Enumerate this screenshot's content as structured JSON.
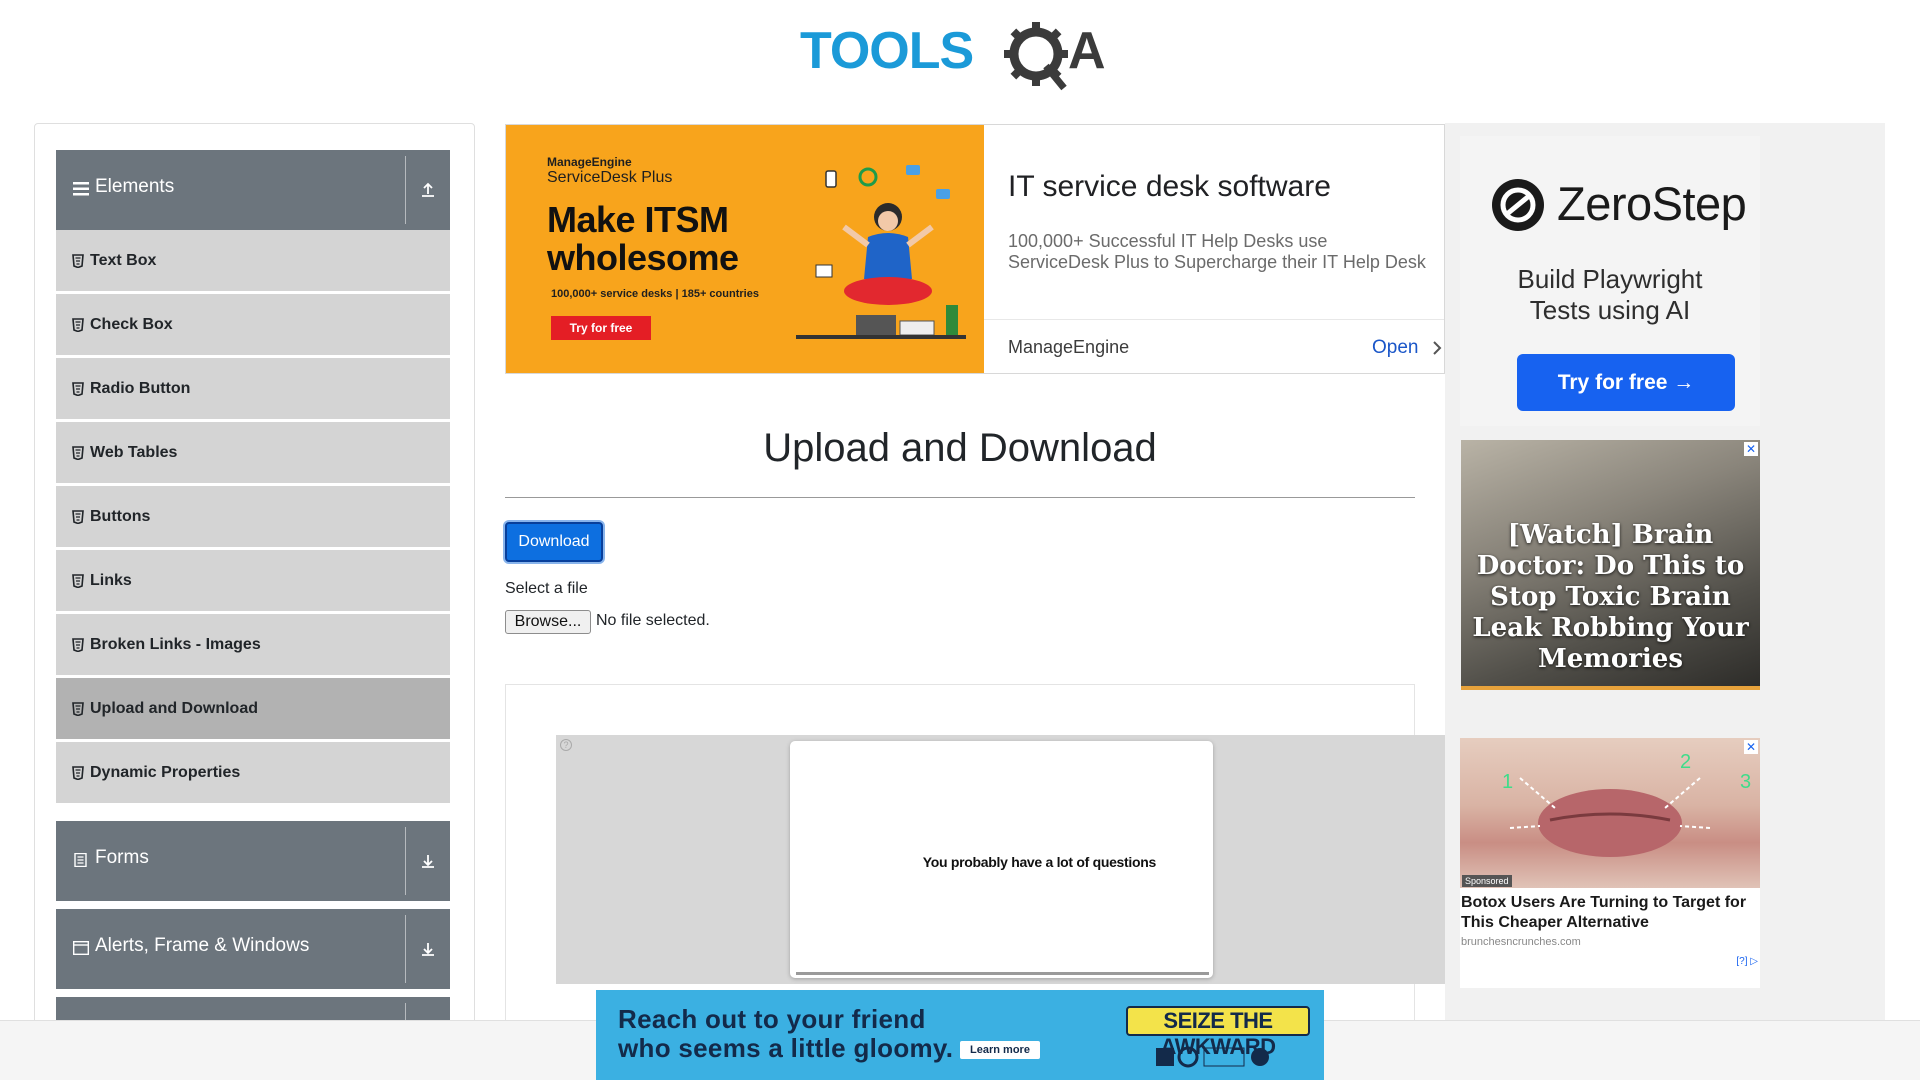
{
  "header": {
    "logo_text": "TOOLSQA"
  },
  "sidebar": {
    "groups": [
      {
        "label": "Elements",
        "icon": "hamburger-icon",
        "expanded": true
      },
      {
        "label": "Forms",
        "icon": "form-icon",
        "expanded": false
      },
      {
        "label": "Alerts, Frame & Windows",
        "icon": "window-icon",
        "expanded": false
      }
    ],
    "items": [
      {
        "label": "Text Box"
      },
      {
        "label": "Check Box"
      },
      {
        "label": "Radio Button"
      },
      {
        "label": "Web Tables"
      },
      {
        "label": "Buttons"
      },
      {
        "label": "Links"
      },
      {
        "label": "Broken Links - Images"
      },
      {
        "label": "Upload and Download",
        "active": true
      },
      {
        "label": "Dynamic Properties"
      }
    ]
  },
  "ad_top": {
    "brand_small": "ManageEngine",
    "brand_product": "ServiceDesk Plus",
    "headline_line1": "Make ITSM",
    "headline_line2": "wholesome",
    "stat": "100,000+ service desks | 185+ countries",
    "banner_cta": "Try for free",
    "title": "IT service desk software",
    "description": "100,000+ Successful IT Help Desks use ServiceDesk Plus to Supercharge their IT Help Desk",
    "advertiser": "ManageEngine",
    "open_label": "Open",
    "banner_color": "#f8a41c"
  },
  "main": {
    "page_title": "Upload and Download",
    "download_label": "Download",
    "select_file_label": "Select a file",
    "browse_label": "Browse...",
    "no_file_text": "No file selected."
  },
  "video_ad": {
    "text": "You probably have a lot of questions"
  },
  "right_ads": {
    "zerostep": {
      "name": "ZeroStep",
      "tagline_line1": "Build Playwright",
      "tagline_line2": "Tests using AI",
      "cta": "Try for free →",
      "button_color": "#1762f0"
    },
    "brain": {
      "text": "[Watch] Brain Doctor: Do This to Stop Toxic Brain Leak Robbing Your Memories"
    },
    "botox": {
      "sponsored": "Sponsored",
      "title": "Botox Users Are Turning to Target for This Cheaper Alternative",
      "domain": "brunchesncrunches.com",
      "adchoice": "[?]"
    }
  },
  "bottom_ad": {
    "line1": "Reach out to your friend",
    "line2": "who seems a little gloomy.",
    "learn_more": "Learn more",
    "campaign": "SEIZE THE AWKWARD",
    "bg_color": "#3bb0e2"
  }
}
